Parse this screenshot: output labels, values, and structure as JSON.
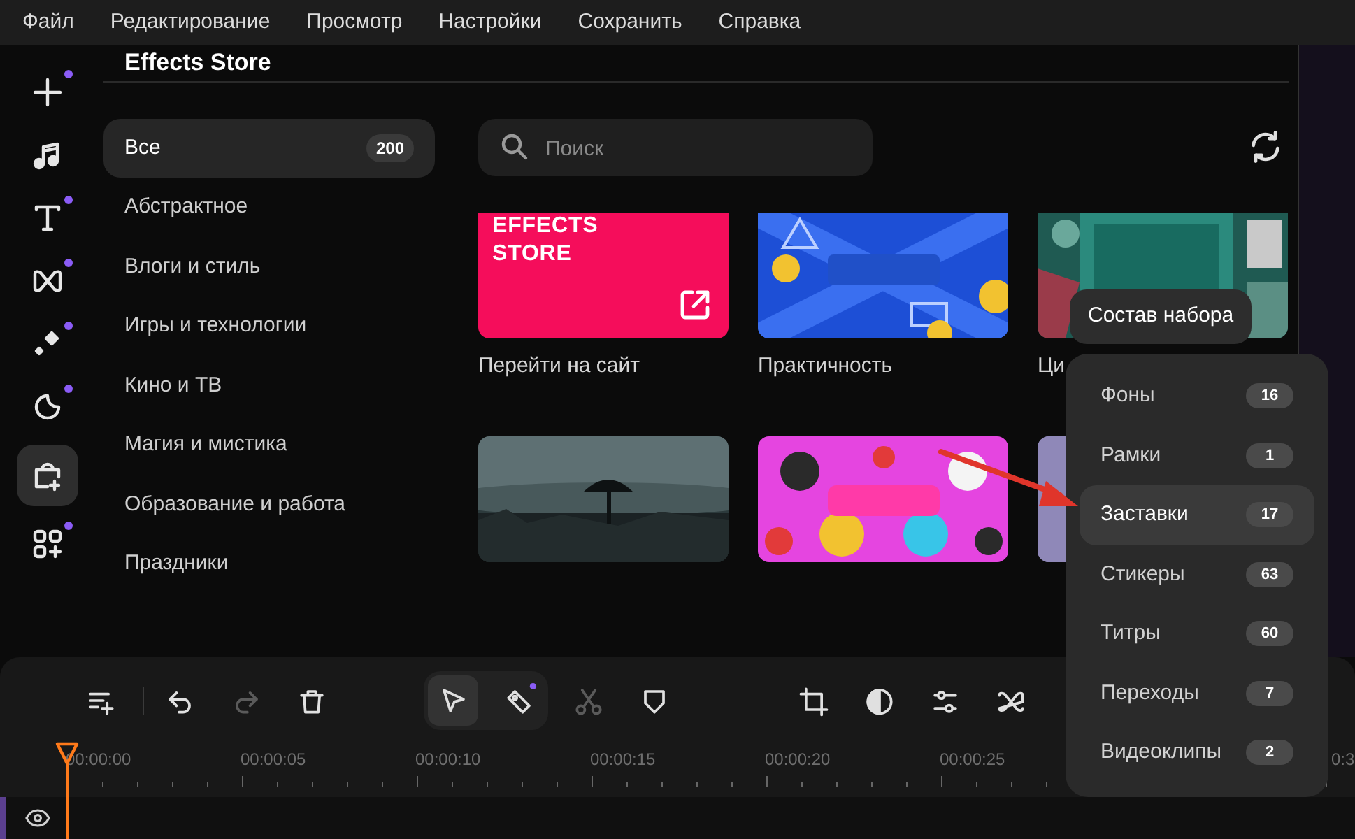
{
  "menu": [
    "Файл",
    "Редактирование",
    "Просмотр",
    "Настройки",
    "Сохранить",
    "Справка"
  ],
  "rail": [
    {
      "dot": true,
      "selected": false
    },
    {
      "dot": false,
      "selected": false
    },
    {
      "dot": true,
      "selected": false
    },
    {
      "dot": true,
      "selected": false
    },
    {
      "dot": true,
      "selected": false
    },
    {
      "dot": true,
      "selected": false
    },
    {
      "dot": false,
      "selected": true
    },
    {
      "dot": true,
      "selected": false
    }
  ],
  "store": {
    "title": "Effects Store",
    "categories": [
      {
        "label": "Все",
        "count": "200",
        "selected": true
      },
      {
        "label": "Абстрактное",
        "selected": false
      },
      {
        "label": "Влоги и стиль",
        "selected": false
      },
      {
        "label": "Игры и технологии",
        "selected": false
      },
      {
        "label": "Кино и ТВ",
        "selected": false
      },
      {
        "label": "Магия и мистика",
        "selected": false
      },
      {
        "label": "Образование и работа",
        "selected": false
      },
      {
        "label": "Праздники",
        "selected": false
      }
    ],
    "search": {
      "placeholder": "Поиск"
    },
    "cards": [
      {
        "kind": "link",
        "title": "EFFECTS STORE",
        "label": "Перейти на сайт"
      },
      {
        "kind": "picture",
        "label": "Практичность"
      },
      {
        "kind": "picture",
        "label": "Ци"
      },
      {
        "kind": "picture"
      },
      {
        "kind": "picture"
      },
      {
        "kind": "picture"
      }
    ]
  },
  "popup": {
    "tooltip": "Состав набора",
    "items": [
      {
        "label": "Фоны",
        "count": "16",
        "selected": false
      },
      {
        "label": "Рамки",
        "count": "1",
        "selected": false
      },
      {
        "label": "Заставки",
        "count": "17",
        "selected": true
      },
      {
        "label": "Стикеры",
        "count": "63",
        "selected": false
      },
      {
        "label": "Титры",
        "count": "60",
        "selected": false
      },
      {
        "label": "Переходы",
        "count": "7",
        "selected": false
      },
      {
        "label": "Видеоклипы",
        "count": "2",
        "selected": false
      }
    ]
  },
  "timeline": {
    "tools": [
      {
        "selected": false,
        "disabled": false,
        "dot": false
      },
      {
        "selected": false,
        "disabled": false,
        "dot": false
      },
      {
        "selected": false,
        "disabled": true,
        "dot": false
      },
      {
        "selected": false,
        "disabled": false,
        "dot": false
      },
      {
        "selected": true,
        "disabled": false,
        "dot": false
      },
      {
        "selected": false,
        "disabled": false,
        "dot": true
      },
      {
        "selected": false,
        "disabled": true,
        "dot": false
      },
      {
        "selected": false,
        "disabled": false,
        "dot": false
      },
      {
        "selected": false,
        "disabled": false,
        "dot": false
      },
      {
        "selected": false,
        "disabled": false,
        "dot": false
      },
      {
        "selected": false,
        "disabled": false,
        "dot": false
      },
      {
        "selected": false,
        "disabled": false,
        "dot": false
      }
    ],
    "ruler": [
      "00:00:00",
      "00:00:05",
      "00:00:10",
      "00:00:15",
      "00:00:20",
      "00:00:25"
    ],
    "ruler_cut": "0:3"
  }
}
